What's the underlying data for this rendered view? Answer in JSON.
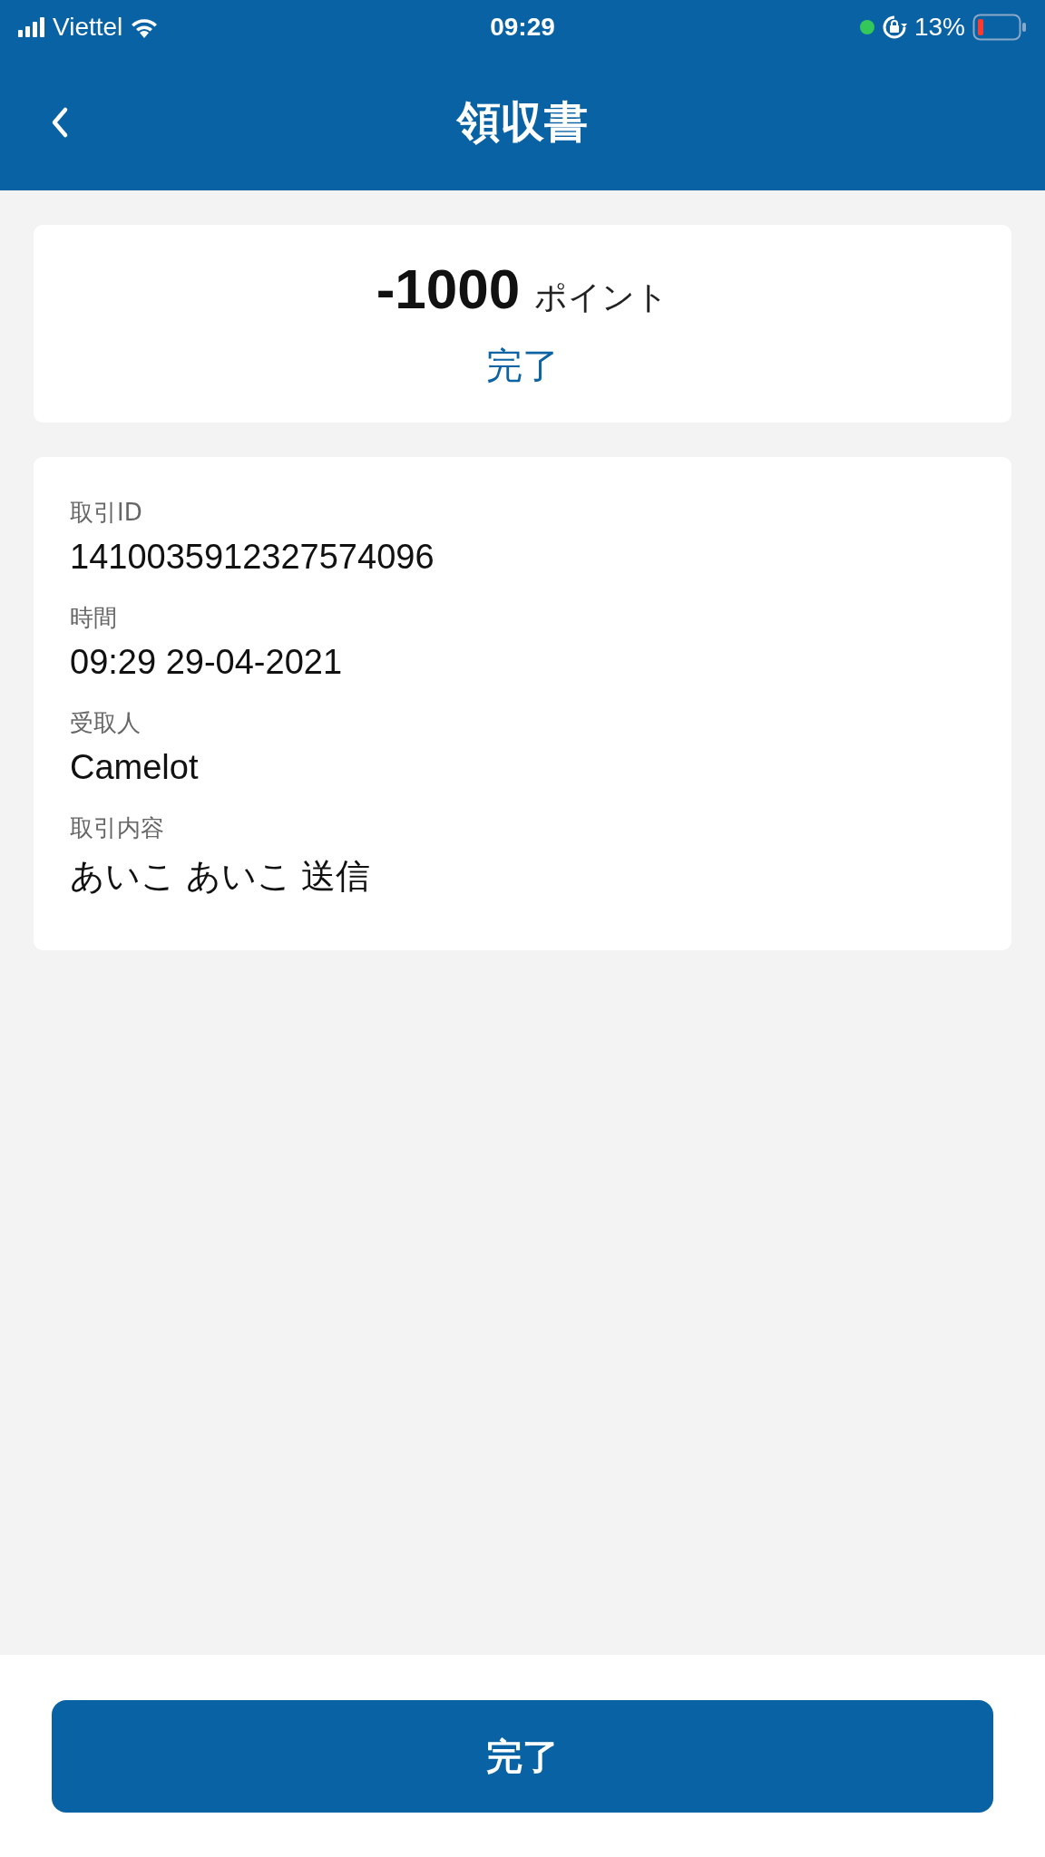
{
  "status_bar": {
    "carrier": "Viettel",
    "time": "09:29",
    "battery": "13%"
  },
  "header": {
    "title": "領収書"
  },
  "summary": {
    "amount": "-1000",
    "unit": "ポイント",
    "status": "完了"
  },
  "details": [
    {
      "label": "取引ID",
      "value": "1410035912327574096"
    },
    {
      "label": "時間",
      "value": "09:29 29-04-2021"
    },
    {
      "label": "受取人",
      "value": "Camelot"
    },
    {
      "label": "取引内容",
      "value": "あいこ あいこ 送信"
    }
  ],
  "footer": {
    "button": "完了"
  }
}
